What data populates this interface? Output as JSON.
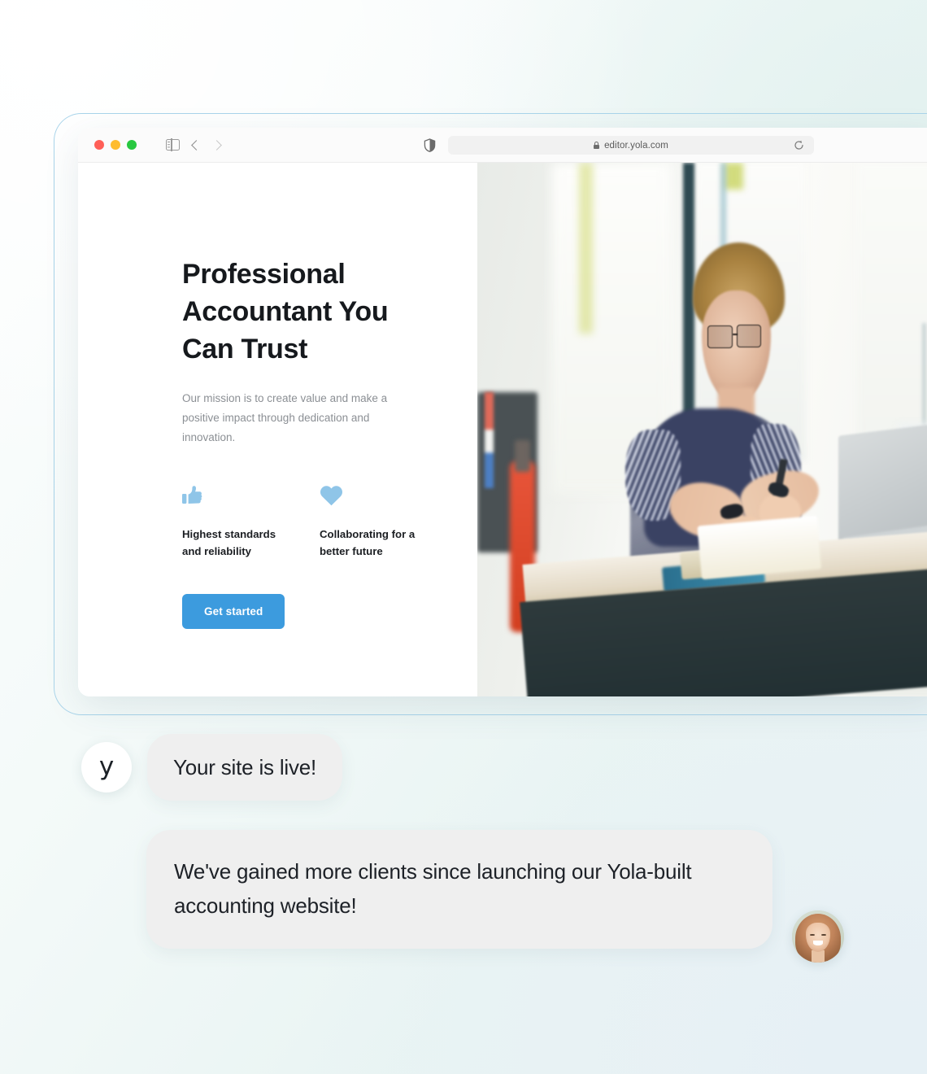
{
  "browser": {
    "url": "editor.yola.com",
    "traffic_lights": [
      "close-red",
      "minimize-yellow",
      "maximize-green"
    ],
    "icons": {
      "sidebar": "sidebar-toggle-icon",
      "back": "back-chevron-icon",
      "forward": "forward-chevron-icon",
      "shield": "privacy-shield-icon",
      "lock": "lock-icon",
      "reload": "reload-icon"
    }
  },
  "site": {
    "headline": "Professional Accountant You Can Trust",
    "subtext": "Our mission is to create value and make a positive impact through dedication and innovation.",
    "features": [
      {
        "icon": "thumbs-up-icon",
        "label": "Highest standards and reliability"
      },
      {
        "icon": "heart-icon",
        "label": "Collaborating for a better future"
      }
    ],
    "cta_label": "Get started",
    "photo_alt": "Accountant working at a standing desk with papers and a laptop"
  },
  "chat": {
    "brand_initial": "y",
    "messages": [
      {
        "from": "yola",
        "text": "Your site is live!"
      },
      {
        "from": "client",
        "text": "We've gained more clients since launching our Yola-built accounting website!"
      }
    ],
    "client_avatar_alt": "Smiling woman with long light-brown hair"
  },
  "colors": {
    "accent_blue": "#3c9bde",
    "icon_blue": "#8fc5e8",
    "bubble_gray": "#efefef",
    "heading_dark": "#16191d",
    "body_gray": "#8b8f94",
    "frame_border": "#a9d4ea"
  }
}
